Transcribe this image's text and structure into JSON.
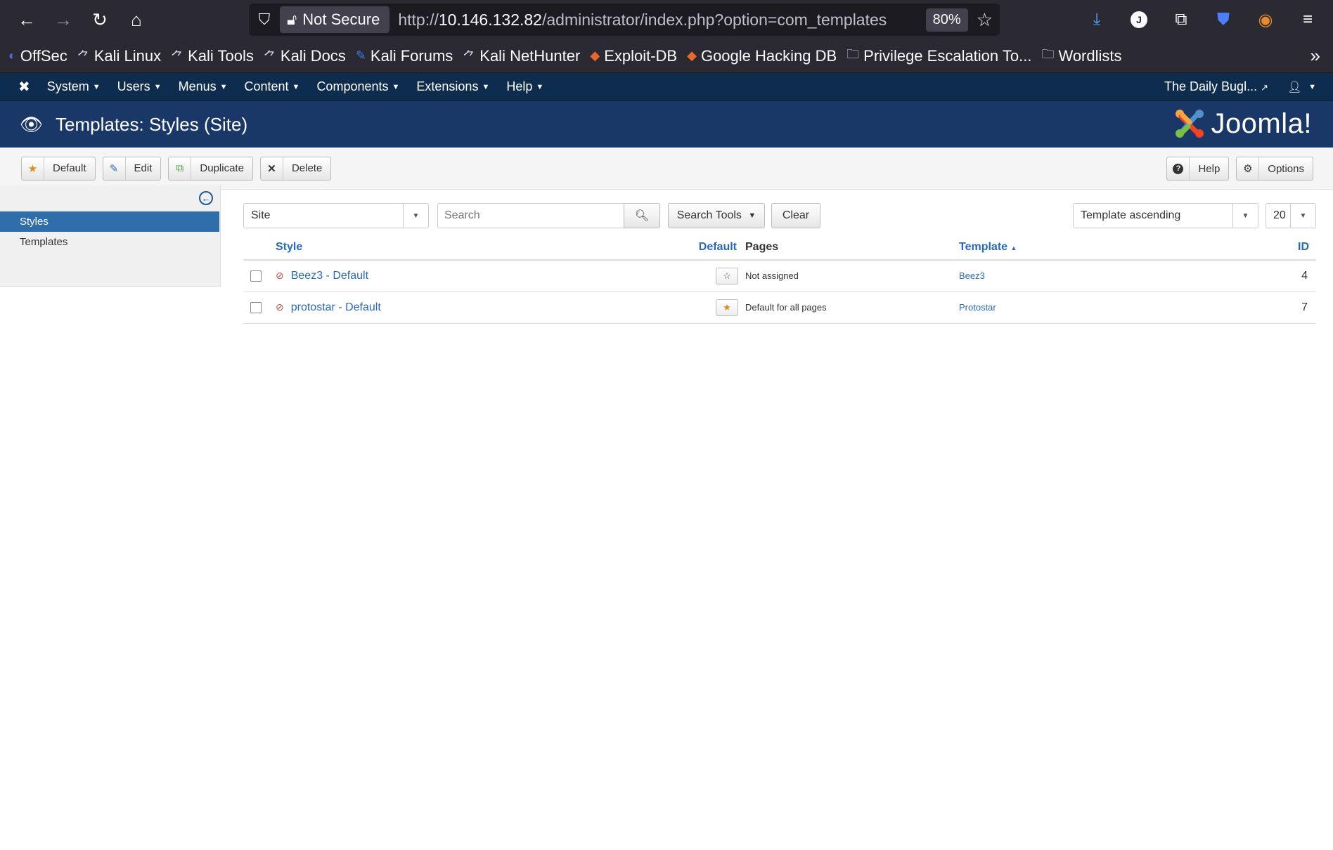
{
  "browser": {
    "not_secure_label": "Not Secure",
    "url_prefix": "http://",
    "url_host": "10.146.132.82",
    "url_path": "/administrator/index.php?option=com_templates",
    "zoom": "80%",
    "bookmarks": [
      {
        "label": "OffSec"
      },
      {
        "label": "Kali Linux"
      },
      {
        "label": "Kali Tools"
      },
      {
        "label": "Kali Docs"
      },
      {
        "label": "Kali Forums"
      },
      {
        "label": "Kali NetHunter"
      },
      {
        "label": "Exploit-DB"
      },
      {
        "label": "Google Hacking DB"
      },
      {
        "label": "Privilege Escalation To..."
      },
      {
        "label": "Wordlists"
      }
    ]
  },
  "nav": {
    "menus": [
      "System",
      "Users",
      "Menus",
      "Content",
      "Components",
      "Extensions",
      "Help"
    ],
    "site_name": "The Daily Bugl..."
  },
  "header": {
    "title": "Templates: Styles (Site)",
    "brand": "Joomla!"
  },
  "toolbar": {
    "default_label": "Default",
    "edit_label": "Edit",
    "duplicate_label": "Duplicate",
    "delete_label": "Delete",
    "help_label": "Help",
    "options_label": "Options"
  },
  "sidebar": {
    "items": [
      {
        "label": "Styles",
        "active": true
      },
      {
        "label": "Templates",
        "active": false
      }
    ]
  },
  "filters": {
    "client": "Site",
    "search_placeholder": "Search",
    "search_tools_label": "Search Tools",
    "clear_label": "Clear",
    "ordering": "Template ascending",
    "limit": "20"
  },
  "table": {
    "headers": {
      "style": "Style",
      "default": "Default",
      "pages": "Pages",
      "template": "Template",
      "id": "ID"
    },
    "rows": [
      {
        "style": "Beez3 - Default",
        "default": false,
        "pages": "Not assigned",
        "template": "Beez3",
        "id": "4"
      },
      {
        "style": "protostar - Default",
        "default": true,
        "pages": "Default for all pages",
        "template": "Protostar",
        "id": "7"
      }
    ]
  },
  "colors": {
    "nav_bg": "#0e2c4d",
    "header_bg": "#1a3867",
    "link": "#2a69b8",
    "active_side": "#2f6eab",
    "star_default": "#e08a17"
  }
}
